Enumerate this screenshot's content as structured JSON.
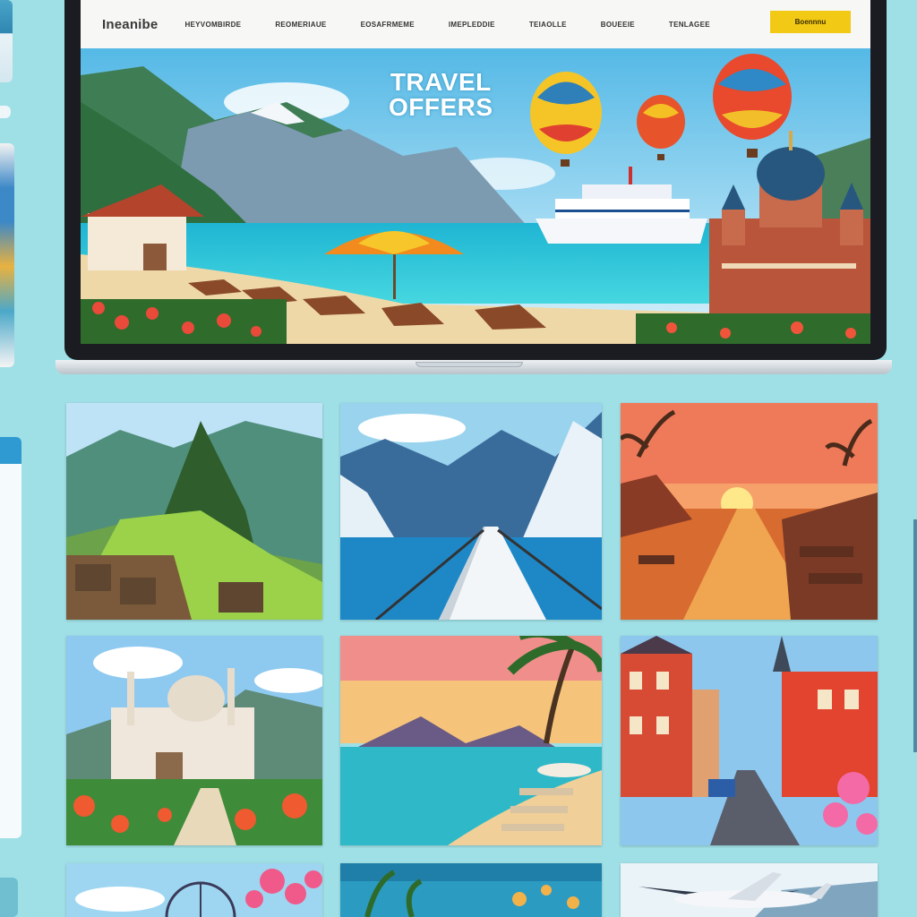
{
  "site": {
    "logo": "Ineanibe",
    "nav_items": [
      "HEYVOMBIRDE",
      "REOMERIAUE",
      "EOSAFRMEME",
      "IMEPLEDDIE",
      "TEIAOLLE",
      "BOUEEIE",
      "TENLAGEE"
    ],
    "cta_label": "Boennnu"
  },
  "hero": {
    "title_line1": "TRAVEL",
    "title_line2": "OFFERS"
  },
  "tiles": [
    {
      "name": "tile-mountain-ruins"
    },
    {
      "name": "tile-ocean-pier"
    },
    {
      "name": "tile-sunset-cafe"
    },
    {
      "name": "tile-palace-garden"
    },
    {
      "name": "tile-tropical-beach"
    },
    {
      "name": "tile-old-town-street"
    },
    {
      "name": "tile-ferris-wheel"
    },
    {
      "name": "tile-reef"
    },
    {
      "name": "tile-airplane"
    }
  ],
  "colors": {
    "page_bg": "#9fe0e6",
    "cta": "#f2c915",
    "sea": "#2ec4d6"
  }
}
